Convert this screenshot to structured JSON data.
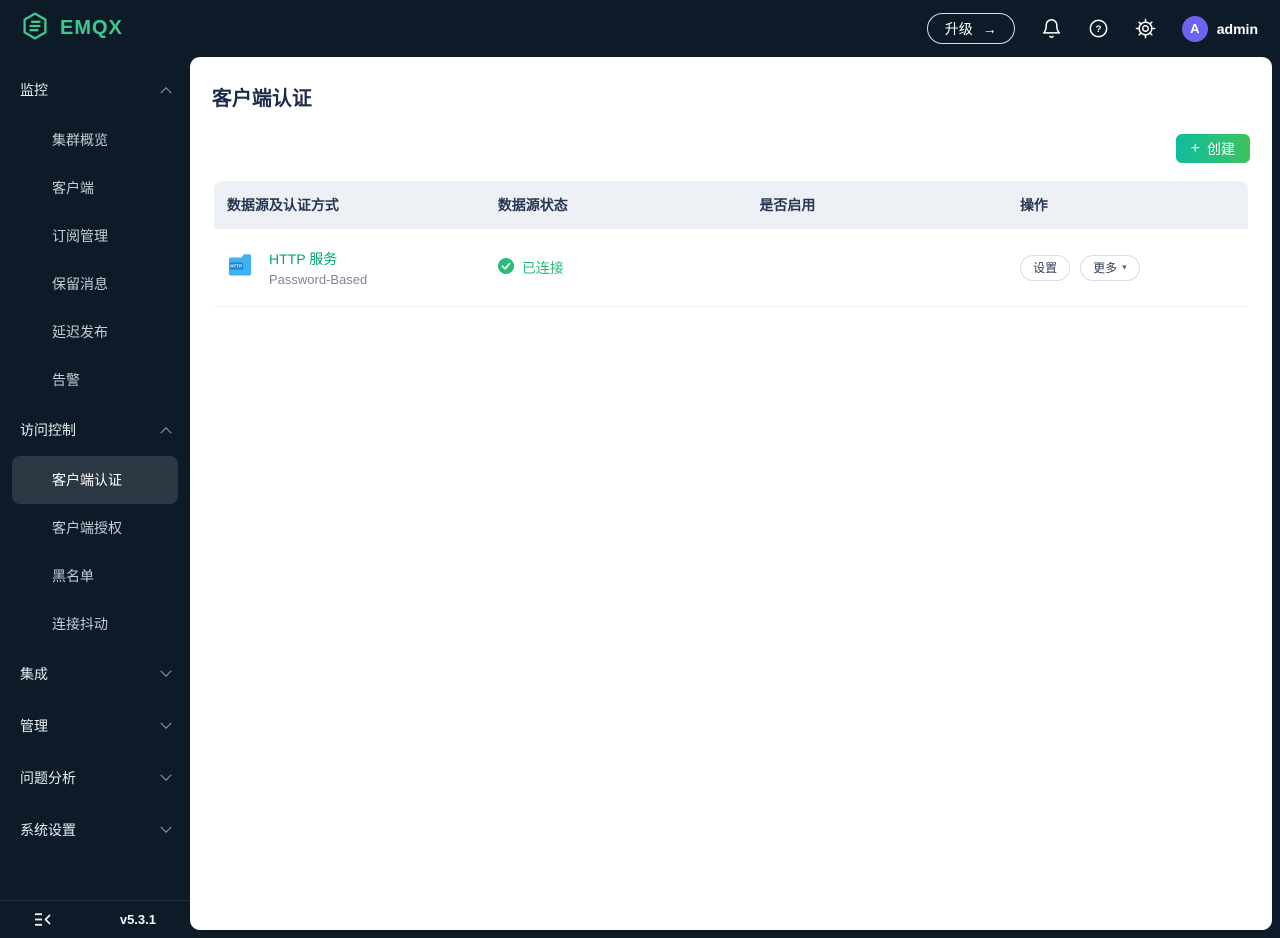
{
  "brand": {
    "name": "EMQX"
  },
  "topbar": {
    "upgrade_label": "升级",
    "user": {
      "initial": "A",
      "name": "admin"
    }
  },
  "icons": {
    "plus": "+",
    "arrow_right": "→",
    "caret_down": "▾",
    "help_glyph": "?"
  },
  "sidebar": {
    "sections": [
      {
        "label": "监控",
        "expanded": true,
        "items": [
          {
            "label": "集群概览"
          },
          {
            "label": "客户端"
          },
          {
            "label": "订阅管理"
          },
          {
            "label": "保留消息"
          },
          {
            "label": "延迟发布"
          },
          {
            "label": "告警"
          }
        ]
      },
      {
        "label": "访问控制",
        "expanded": true,
        "items": [
          {
            "label": "客户端认证",
            "active": true
          },
          {
            "label": "客户端授权"
          },
          {
            "label": "黑名单"
          },
          {
            "label": "连接抖动"
          }
        ]
      },
      {
        "label": "集成",
        "expanded": false
      },
      {
        "label": "管理",
        "expanded": false
      },
      {
        "label": "问题分析",
        "expanded": false
      },
      {
        "label": "系统设置",
        "expanded": false
      }
    ],
    "footer": {
      "version": "v5.3.1"
    }
  },
  "main": {
    "title": "客户端认证",
    "create_button": "创建",
    "table": {
      "columns": [
        "数据源及认证方式",
        "数据源状态",
        "是否启用",
        "操作"
      ],
      "rows": [
        {
          "name": "HTTP 服务",
          "mechanism": "Password-Based",
          "status": "已连接",
          "enabled": true,
          "actions": {
            "settings": "设置",
            "more": "更多"
          }
        }
      ]
    }
  },
  "colors": {
    "background_dark": "#0d1b28",
    "brand_green": "#3ec78f",
    "link_green": "#00a86e",
    "status_green": "#2abb76",
    "toggle_green": "#2cbd6f",
    "create_gradient_start": "#0fbda0",
    "create_gradient_end": "#3ec25b",
    "avatar_purple": "#6e62f0",
    "table_header_bg": "#edf1f6",
    "title_navy": "#1f2b4d"
  }
}
